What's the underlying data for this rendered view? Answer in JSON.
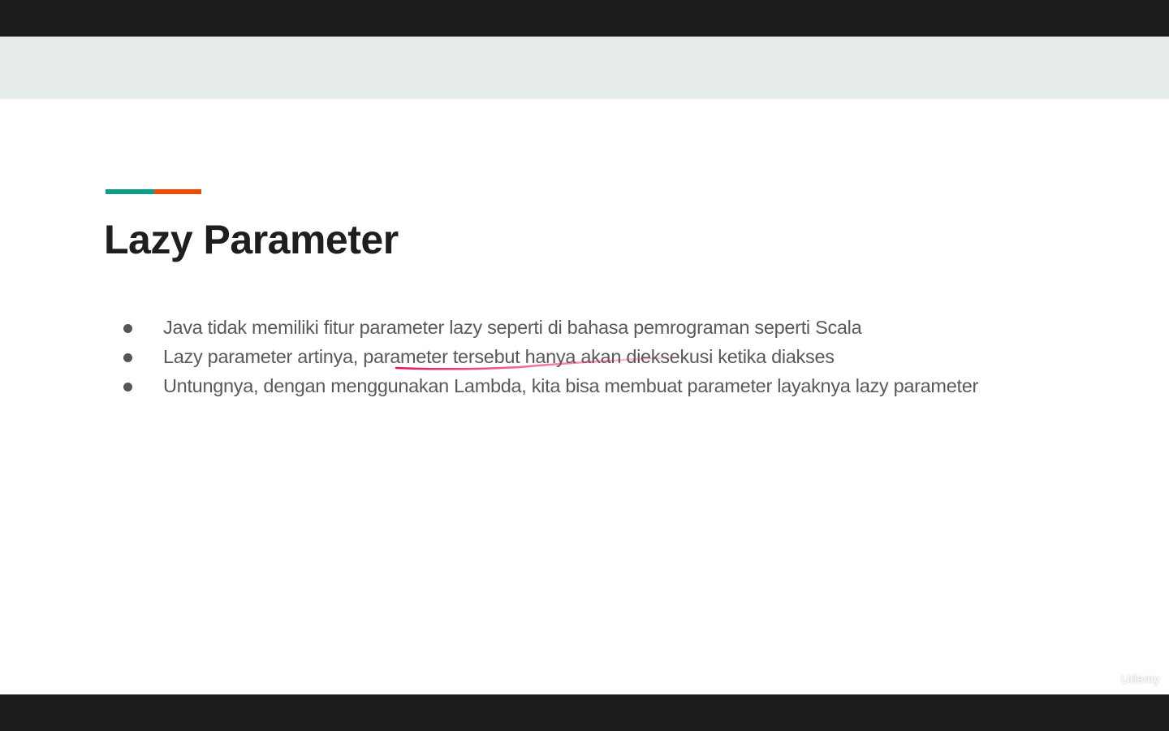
{
  "slide": {
    "title": "Lazy Parameter",
    "accent_colors": [
      "#0d9e8a",
      "#f24a05"
    ],
    "bullets": [
      "Java tidak memiliki fitur parameter lazy seperti di bahasa pemrograman seperti Scala",
      "Lazy parameter artinya, parameter tersebut hanya akan dieksekusi ketika diakses",
      "Untungnya, dengan menggunakan Lambda, kita bisa membuat parameter layaknya lazy parameter"
    ],
    "annotation_color": "#e8174f"
  },
  "watermark": "Udemy"
}
